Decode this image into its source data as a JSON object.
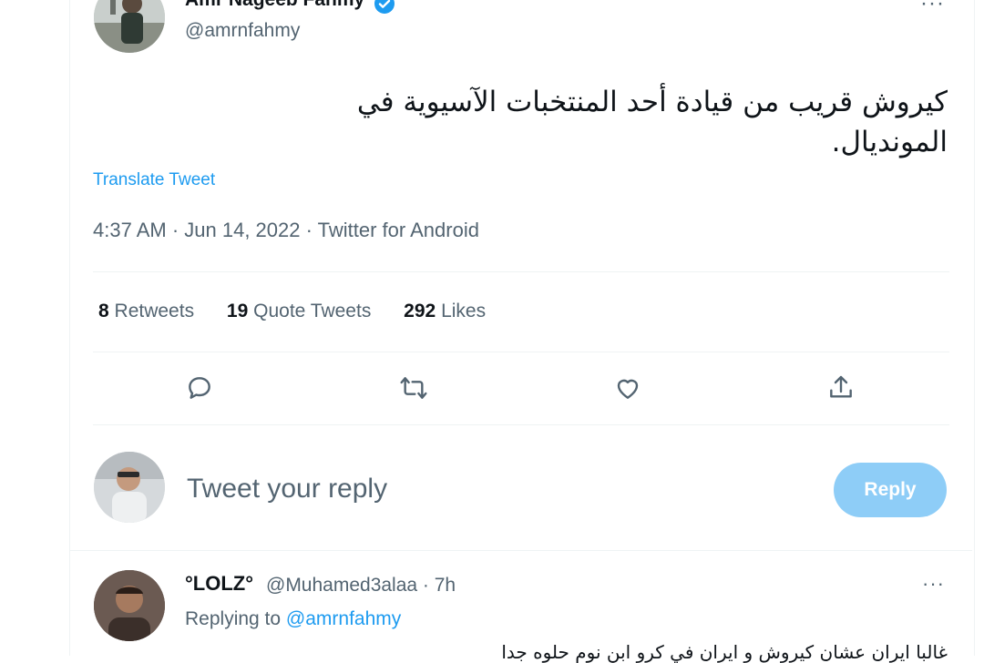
{
  "tweet": {
    "author_name": "Amr Nageeb Fahmy",
    "author_handle": "@amrnfahmy",
    "text_line1": "كيروش قريب من قيادة أحد المنتخبات الآسيوية في",
    "text_line2": "المونديال.",
    "translate_label": "Translate Tweet",
    "meta": "4:37 AM · Jun 14, 2022 · Twitter for Android",
    "more_icon": "···"
  },
  "stats": {
    "retweets_count": "8",
    "retweets_label": "Retweets",
    "quotes_count": "19",
    "quotes_label": "Quote Tweets",
    "likes_count": "292",
    "likes_label": "Likes"
  },
  "actions": {
    "icons": [
      "reply-icon",
      "retweet-icon",
      "like-icon",
      "share-icon"
    ]
  },
  "reply_box": {
    "placeholder": "Tweet your reply",
    "button_label": "Reply"
  },
  "comment": {
    "name": "°LOLZ°",
    "handle_time": "@Muhamed3alaa · 7h",
    "replying_prefix": "Replying to",
    "replying_handle": "@amrnfahmy",
    "more_icon": "···",
    "text": "غالبا ايران عشان كيروش و ايران في كرو ابن نوم حلوه جدا"
  },
  "colors": {
    "accent": "#1d9bf0",
    "reply_button": "#8ecdf7",
    "secondary_text": "#536471"
  }
}
